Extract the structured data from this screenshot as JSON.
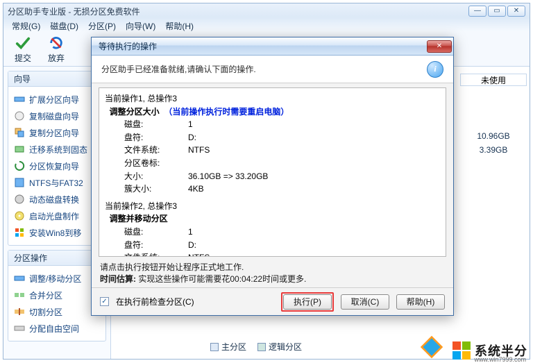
{
  "window": {
    "title": "分区助手专业版 - 无损分区免费软件"
  },
  "menu": [
    "常规(G)",
    "磁盘(D)",
    "分区(P)",
    "向导(W)",
    "帮助(H)"
  ],
  "toolbar": [
    {
      "label": "提交"
    },
    {
      "label": "放弃"
    }
  ],
  "wizard_panel": {
    "title": "向导",
    "items": [
      "扩展分区向导",
      "复制磁盘向导",
      "复制分区向导",
      "迁移系统到固态",
      "分区恢复向导",
      "NTFS与FAT32",
      "动态磁盘转换",
      "启动光盘制作",
      "安装Win8到移"
    ]
  },
  "ops_panel": {
    "title": "分区操作",
    "items": [
      "调整/移动分区",
      "合并分区",
      "切割分区",
      "分配自由空间"
    ]
  },
  "right": {
    "header": "未使用",
    "rows": [
      "10.96GB",
      "3.39GB"
    ]
  },
  "legend": {
    "primary": "主分区",
    "logical": "逻辑分区"
  },
  "dialog": {
    "title": "等待执行的操作",
    "info": "分区助手已经准备就绪,请确认下面的操作.",
    "op1_header": "当前操作1, 总操作3",
    "op1_title": "调整分区大小",
    "op1_note": "（当前操作执行时需要重启电脑）",
    "op1_rows": {
      "disk_k": "磁盘:",
      "disk_v": "1",
      "drive_k": "盘符:",
      "drive_v": "D:",
      "fs_k": "文件系统:",
      "fs_v": "NTFS",
      "label_k": "分区卷标:",
      "label_v": "",
      "size_k": "大小:",
      "size_v": "36.10GB => 33.20GB",
      "cluster_k": "簇大小:",
      "cluster_v": "4KB"
    },
    "op2_header": "当前操作2, 总操作3",
    "op2_title": "调整并移动分区",
    "op2_rows": {
      "disk_k": "磁盘:",
      "disk_v": "1",
      "drive_k": "盘符:",
      "drive_v": "D:",
      "fs_k": "文件系统:",
      "fs_v": "NTFS"
    },
    "hint": "请点击执行按钮开始让程序正式地工作.",
    "time_label": "时间估算:",
    "time_text": "实现这些操作可能需要花00:04:22时间或更多.",
    "checkbox": "在执行前检查分区(C)",
    "btn_exec": "执行(P)",
    "btn_cancel": "取消(C)",
    "btn_help": "帮助(H)"
  },
  "watermark": {
    "text": "系统半分",
    "url": "www.win7999.com"
  }
}
